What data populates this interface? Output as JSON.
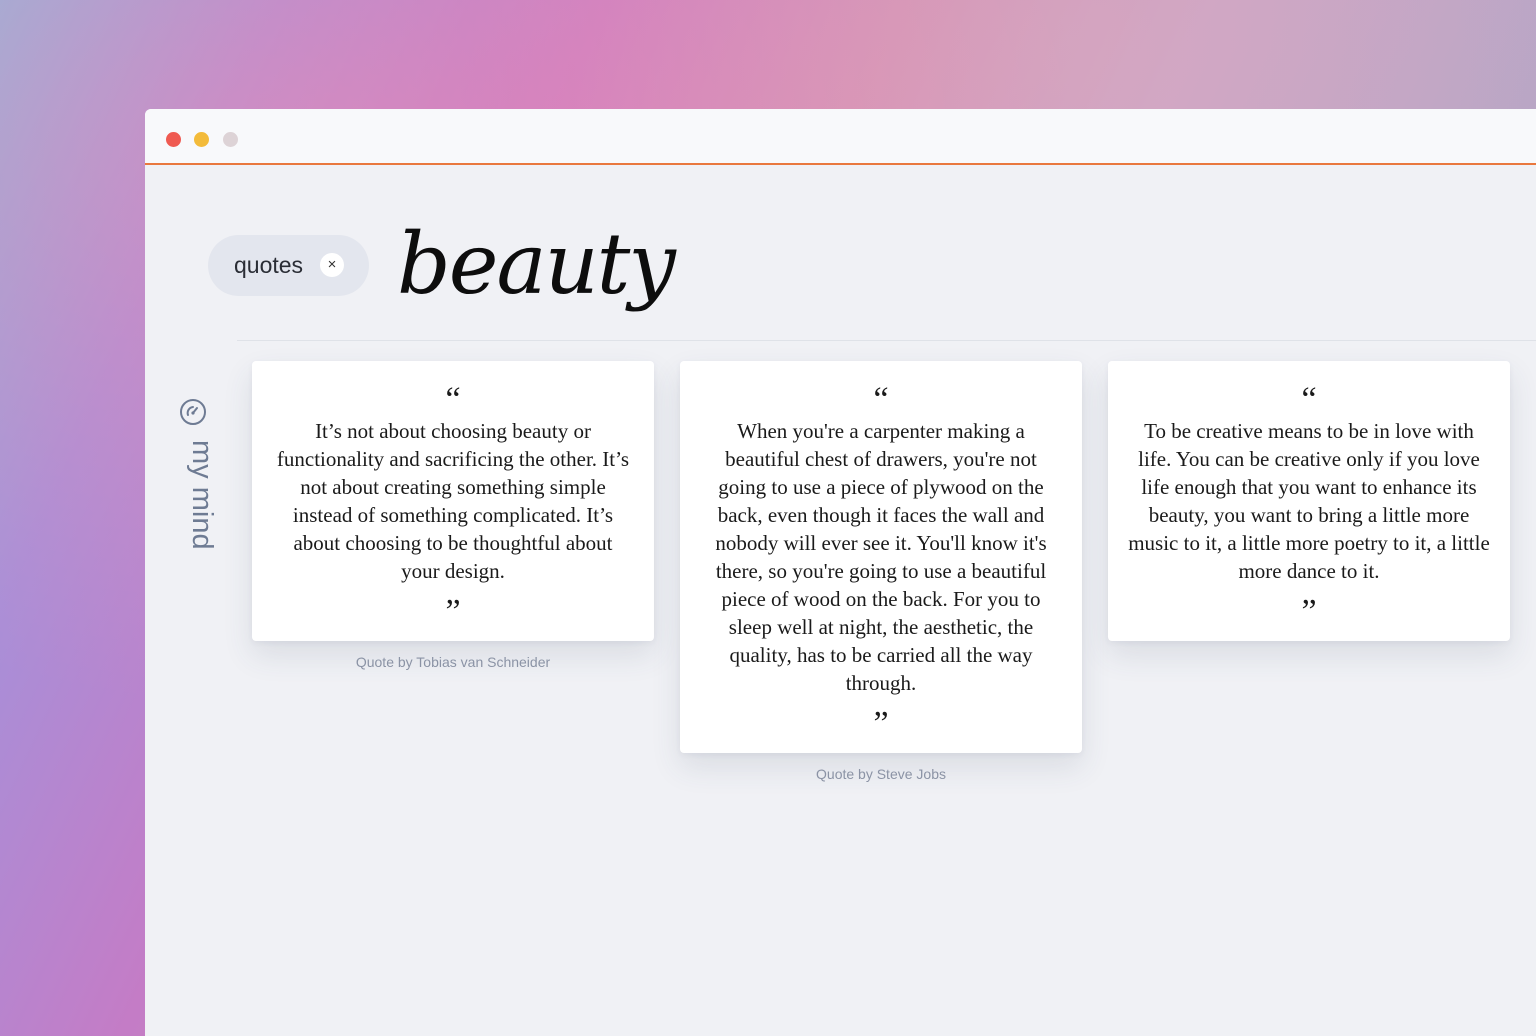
{
  "window": {
    "controls": [
      "close",
      "minimize",
      "zoom"
    ]
  },
  "filter_chip": {
    "label": "quotes",
    "remove_symbol": "×"
  },
  "page_title": "beauty",
  "sidebar": {
    "label": "my mind",
    "icon": "gauge-icon"
  },
  "quotes": [
    {
      "open_mark": "“",
      "text": "It’s not about choosing beauty or functionality and sacrificing the other. It’s not about creating something simple instead of something complicated. It’s about choosing to be thoughtful about your design.",
      "close_mark": "”",
      "attribution": "Quote by Tobias van Schneider"
    },
    {
      "open_mark": "“",
      "text": "When you're a carpenter making a beautiful chest of drawers, you're not going to use a piece of plywood on the back, even though it faces the wall and nobody will ever see it. You'll know it's there, so you're going to use a beautiful piece of wood on the back. For you to sleep well at night, the aesthetic, the quality, has to be carried all the way through.",
      "close_mark": "”",
      "attribution": "Quote by Steve Jobs"
    },
    {
      "open_mark": "“",
      "text": "To be creative means to be in love with life. You can be creative only if you love life enough that you want to enhance its beauty, you want to bring a little more music to it, a little more poetry to it, a little more dance to it.",
      "close_mark": "”"
    }
  ]
}
